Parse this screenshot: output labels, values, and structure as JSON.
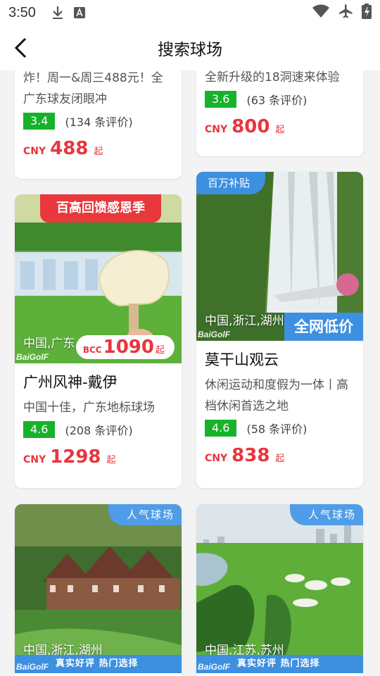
{
  "status_bar": {
    "time": "3:50",
    "icons": [
      "download-icon",
      "font-a-icon",
      "wifi-icon",
      "airplane-icon",
      "battery-icon"
    ]
  },
  "header": {
    "title": "搜索球场",
    "back_icon": "chevron-left-icon"
  },
  "colors": {
    "price": "#e8353f",
    "score_bg": "#16b22a",
    "badge_blue": "#3d8fe0",
    "ribbon_red": "#e8383c"
  },
  "cards": [
    {
      "desc": "炸！周一&周三488元！全广东球友闭眼冲",
      "score": "3.4",
      "reviews": "(134 条评价)",
      "currency": "CNY",
      "price": "488",
      "price_suffix": "起"
    },
    {
      "desc": "全新升级的18洞速来体验",
      "score": "3.6",
      "reviews": "(63 条评价)",
      "currency": "CNY",
      "price": "800",
      "price_suffix": "起"
    },
    {
      "ribbon": "百高回馈感恩季",
      "location": "中国,广东,广州",
      "brand": "BaiGolF",
      "overlay_currency": "BCC",
      "overlay_price": "1090",
      "overlay_suffix": "起",
      "name": "广州风神-戴伊",
      "desc": "中国十佳，广东地标球场",
      "score": "4.6",
      "reviews": "(208 条评价)",
      "currency": "CNY",
      "price": "1298",
      "price_suffix": "起"
    },
    {
      "badge": "百万补贴",
      "location": "中国,浙江,湖州",
      "brand": "BaiGolF",
      "lowest_label": "全网低价",
      "name": "莫干山观云",
      "desc": "休闲运动和度假为一体丨高档休闲首选之地",
      "score": "4.6",
      "reviews": "(58 条评价)",
      "currency": "CNY",
      "price": "838",
      "price_suffix": "起"
    },
    {
      "badge": "人气球场",
      "location": "中国,浙江,湖州",
      "brand": "BaiGolF",
      "bottom_bar": "真实好评  热门选择"
    },
    {
      "badge": "人气球场",
      "location": "中国,江苏,苏州",
      "brand": "BaiGolF",
      "bottom_bar": "真实好评  热门选择"
    }
  ]
}
